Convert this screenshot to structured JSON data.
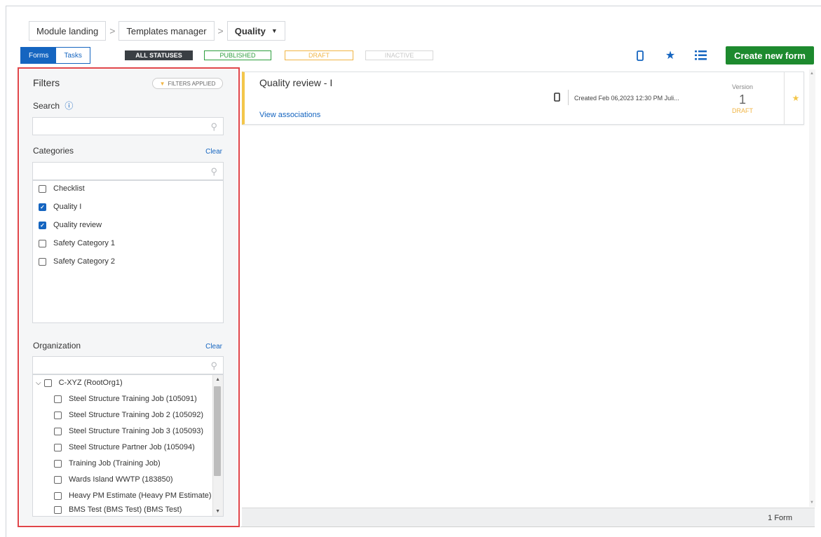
{
  "breadcrumb": {
    "items": [
      "Module landing",
      "Templates manager"
    ],
    "separator": ">",
    "current": "Quality"
  },
  "toolbar": {
    "tabs": {
      "forms": "Forms",
      "tasks": "Tasks"
    },
    "statuses": {
      "all": "ALL STATUSES",
      "published": "PUBLISHED",
      "draft": "DRAFT",
      "inactive": "INACTIVE"
    },
    "icons": [
      "mobile-icon",
      "star-icon",
      "list-icon"
    ],
    "create_label": "Create new form"
  },
  "filters": {
    "title": "Filters",
    "applied_label": "FILTERS APPLIED",
    "search_label": "Search",
    "search_value": "",
    "categories_label": "Categories",
    "categories_clear": "Clear",
    "categories_search_value": "",
    "categories": [
      {
        "label": "Checklist",
        "checked": false
      },
      {
        "label": "Quality I",
        "checked": true
      },
      {
        "label": "Quality review",
        "checked": true
      },
      {
        "label": "Safety Category 1",
        "checked": false
      },
      {
        "label": "Safety Category 2",
        "checked": false
      }
    ],
    "organization_label": "Organization",
    "organization_clear": "Clear",
    "organization_search_value": "",
    "org_root": "C-XYZ (RootOrg1)",
    "org_children": [
      "Steel Structure Training Job (105091)",
      "Steel Structure Training Job 2 (105092)",
      "Steel Structure Training Job 3 (105093)",
      "Steel Structure Partner Job (105094)",
      "Training Job (Training Job)",
      "Wards Island WWTP (183850)",
      "Heavy PM Estimate (Heavy PM Estimate)",
      "BMS Test (BMS Test) (BMS Test)"
    ]
  },
  "card": {
    "title": "Quality review - I",
    "link": "View associations",
    "created": "Created Feb 06,2023 12:30 PM Juli...",
    "version_label": "Version",
    "version_number": "1",
    "status": "DRAFT"
  },
  "footer": {
    "count": "1 Form"
  },
  "colors": {
    "accent": "#1565c0",
    "create": "#1d8a2e",
    "draft": "#f0b545",
    "highlight": "#e0464a"
  }
}
